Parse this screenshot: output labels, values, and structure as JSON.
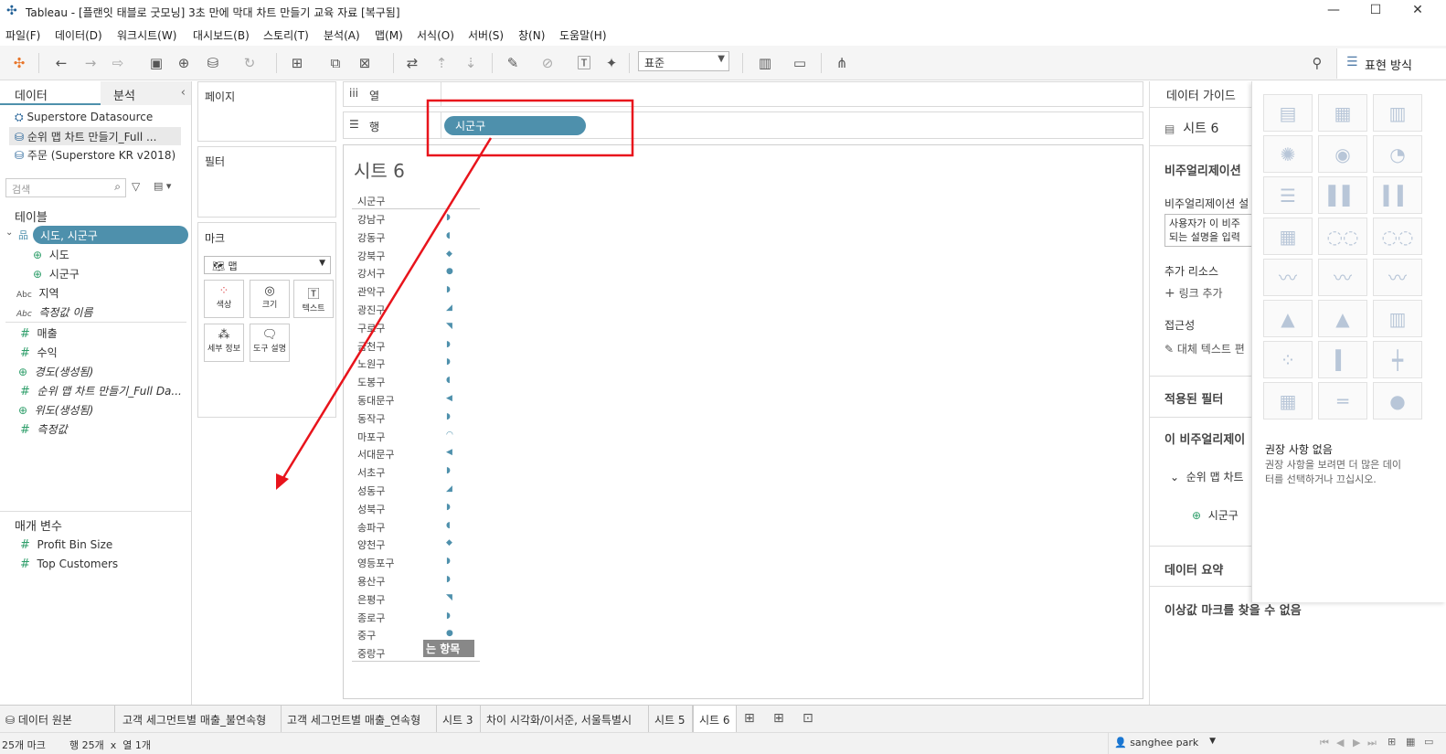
{
  "window": {
    "title": "Tableau - [플랜잇 태블로 굿모닝] 3초 만에 막대 차트 만들기 교육 자료 [복구됨]",
    "minimize": "—",
    "maximize": "☐",
    "close": "✕"
  },
  "menu": [
    "파일(F)",
    "데이터(D)",
    "워크시트(W)",
    "대시보드(B)",
    "스토리(T)",
    "분석(A)",
    "맵(M)",
    "서식(O)",
    "서버(S)",
    "창(N)",
    "도움말(H)"
  ],
  "toolbar": {
    "standard_select": "표준",
    "show_me_label": "표현 방식"
  },
  "left_panel": {
    "tab_data": "데이터",
    "tab_analysis": "분석",
    "datasources": [
      "Superstore Datasource",
      "순위 맵 차트 만들기_Full ...",
      "주문 (Superstore KR v2018)"
    ],
    "search_placeholder": "검색",
    "tables_header": "테이블",
    "hierarchy": "시도, 시군구",
    "fields": [
      {
        "type": "globe",
        "name": "시도"
      },
      {
        "type": "globe",
        "name": "시군구"
      },
      {
        "type": "Abc",
        "name": "지역"
      },
      {
        "type": "Abc",
        "name": "측정값 이름"
      },
      {
        "type": "#",
        "name": "매출"
      },
      {
        "type": "#",
        "name": "수익"
      },
      {
        "type": "globe",
        "name": "경도(생성됨)"
      },
      {
        "type": "#",
        "name": "순위 맵 차트 만들기_Full Da..."
      },
      {
        "type": "globe",
        "name": "위도(생성됨)"
      },
      {
        "type": "#",
        "name": "측정값"
      }
    ],
    "params_header": "매개 변수",
    "params": [
      "Profit Bin Size",
      "Top Customers"
    ]
  },
  "shelves": {
    "pages": "페이지",
    "filters": "필터",
    "marks": "마크",
    "mark_type": "맵",
    "mark_cards": [
      "색상",
      "크기",
      "텍스트",
      "세부 정보",
      "도구 설명"
    ],
    "columns": "열",
    "rows": "행",
    "rows_pill": "시군구"
  },
  "viz": {
    "sheet_title": "시트 6",
    "col_header": "시군구",
    "rows": [
      "강남구",
      "강동구",
      "강북구",
      "강서구",
      "관악구",
      "광진구",
      "구로구",
      "금천구",
      "노원구",
      "도봉구",
      "동대문구",
      "동작구",
      "마포구",
      "서대문구",
      "서초구",
      "성동구",
      "성북구",
      "송파구",
      "양천구",
      "영등포구",
      "용산구",
      "은평구",
      "종로구",
      "중구",
      "중랑구"
    ],
    "drag_label": "는 항목"
  },
  "data_guide": {
    "tab": "데이터 가이드",
    "sheet": "시트 6",
    "viz_desc_header": "비주얼리제이션",
    "viz_desc_sub": "비주얼리제이션 설",
    "desc_box": "사용자가 이 비주 되는 설명을 입력",
    "extra_resources": "추가 리소스",
    "add_link": "링크 추가",
    "accessibility": "접근성",
    "alt_text": "대체 텍스트 편",
    "applied_filters": "적용된 필터",
    "this_viz": "이 비주얼리제이",
    "datasource_item": "순위 맵 차트",
    "field_item": "시군구",
    "data_summary": "데이터 요약",
    "outliers": "이상값 마크를 찾을 수 없음"
  },
  "show_me": {
    "no_suggestion": "권장 사항 없음",
    "hint": "권장 사항을 보려면 더 많은 데이터를 선택하거나 끄십시오."
  },
  "sheet_tabs": [
    "데이터 원본",
    "고객 세그먼트별 매출_불연속형",
    "고객 세그먼트별 매출_연속형",
    "시트 3",
    "차이 시각화/이서준, 서울특별시",
    "시트 5",
    "시트 6"
  ],
  "status": {
    "marks": "25개 마크",
    "rows_cols": "행 25개  x  열 1개",
    "user": "sanghee park"
  },
  "colors": {
    "pill": "#4e90ac",
    "annotation_red": "#e8141c"
  }
}
